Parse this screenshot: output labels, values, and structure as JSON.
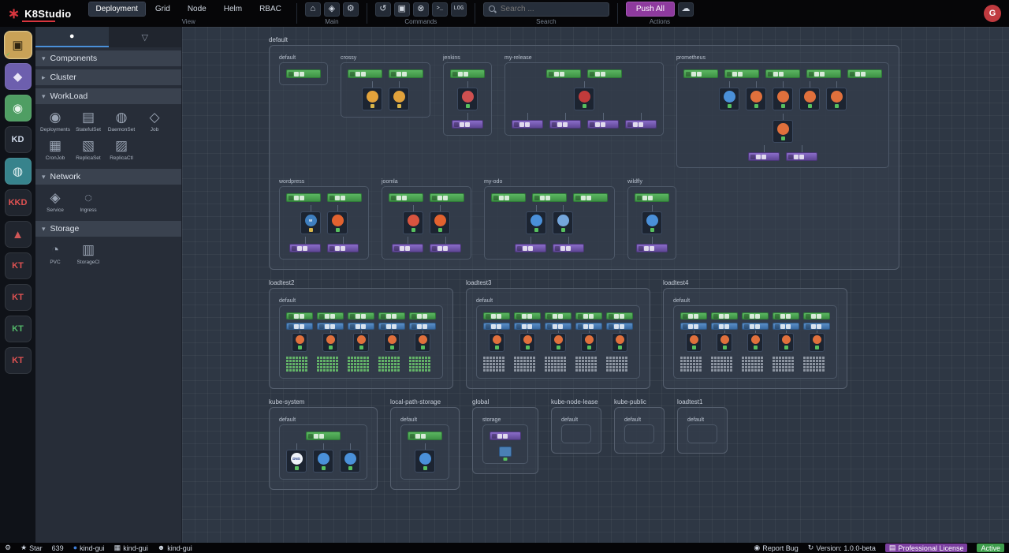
{
  "colors": {
    "accent_blue": "#4a90d9",
    "push_button": "#8e3a9e",
    "avatar_red": "#c03a3f",
    "logo_red": "#d9363e",
    "active_green": "#3f9e4d",
    "license_purple": "#7b3fa0",
    "canvas_bg": "#2e3744"
  },
  "topbar": {
    "logo_text": "K8Studio",
    "group_labels": {
      "view": "View",
      "main": "Main",
      "commands": "Commands",
      "search": "Search",
      "actions": "Actions"
    },
    "tabs": [
      {
        "label": "Deployment",
        "active": true
      },
      {
        "label": "Grid",
        "active": false
      },
      {
        "label": "Node",
        "active": false
      },
      {
        "label": "Helm",
        "active": false
      },
      {
        "label": "RBAC",
        "active": false
      }
    ],
    "main_icons": [
      {
        "name": "home-icon",
        "glyph": "⌂"
      },
      {
        "name": "studio-ship-icon",
        "glyph": "◈"
      },
      {
        "name": "settings-gear-icon",
        "glyph": "⚙"
      }
    ],
    "command_icons": [
      {
        "name": "undo-icon",
        "glyph": "↺"
      },
      {
        "name": "save-icon",
        "glyph": "▣"
      },
      {
        "name": "stop-icon",
        "glyph": "⊗"
      },
      {
        "name": "terminal-icon",
        "glyph": ">_"
      },
      {
        "name": "log-icon",
        "glyph": "LOG"
      }
    ],
    "search_placeholder": "Search ...",
    "push_all_label": "Push All",
    "cloud_icon_glyph": "☁",
    "avatar_letter": "G"
  },
  "rail": {
    "items": [
      {
        "name": "cluster-amber",
        "type": "glyph",
        "glyph": "▣",
        "bg": "#c9a257",
        "fg": "#2e2410",
        "badge": "✓",
        "selected": true
      },
      {
        "name": "cluster-purple",
        "type": "glyph",
        "glyph": "◆",
        "bg": "#6d5fae",
        "fg": "#e8e4f5"
      },
      {
        "name": "cluster-green-pin",
        "type": "glyph",
        "glyph": "◉",
        "bg": "#4f9e63",
        "fg": "#eaf6ee"
      },
      {
        "name": "cluster-kd",
        "type": "text",
        "text": "KD",
        "bg": "#20252e",
        "fg": "#ccd6e6"
      },
      {
        "name": "cluster-teal-flask",
        "type": "glyph",
        "glyph": "◍",
        "bg": "#37838c",
        "fg": "#e7f4f5"
      },
      {
        "name": "cluster-kkd",
        "type": "text",
        "text": "KKD",
        "bg": "#20252e",
        "fg": "#e05252"
      },
      {
        "name": "cluster-rocket",
        "type": "glyph",
        "glyph": "▲",
        "bg": "#20252e",
        "fg": "#d05757"
      },
      {
        "name": "cluster-kt-1",
        "type": "text",
        "text": "KT",
        "bg": "#20252e",
        "fg": "#e05252"
      },
      {
        "name": "cluster-kt-2",
        "type": "text",
        "text": "KT",
        "bg": "#20252e",
        "fg": "#e05252"
      },
      {
        "name": "cluster-kt-3",
        "type": "text",
        "text": "KT",
        "bg": "#20252e",
        "fg": "#53b96a"
      },
      {
        "name": "cluster-kt-4",
        "type": "text",
        "text": "KT",
        "bg": "#20252e",
        "fg": "#e05252"
      }
    ]
  },
  "sidebar": {
    "tabs": [
      {
        "name": "tab-components",
        "glyph": "●",
        "active": true
      },
      {
        "name": "tab-filter",
        "glyph": "▽",
        "active": false
      }
    ],
    "sections": [
      {
        "label": "Components",
        "expanded": true,
        "items": []
      },
      {
        "label": "Cluster",
        "expanded": false,
        "items": []
      },
      {
        "label": "WorkLoad",
        "expanded": true,
        "items": [
          {
            "label": "Deployments",
            "glyph": "◉"
          },
          {
            "label": "StatefulSet",
            "glyph": "▤"
          },
          {
            "label": "DaemonSet",
            "glyph": "◍"
          },
          {
            "label": "Job",
            "glyph": "◇"
          },
          {
            "label": "CronJob",
            "glyph": "▦"
          },
          {
            "label": "ReplicaSet",
            "glyph": "▧"
          },
          {
            "label": "ReplicaCtl",
            "glyph": "▨"
          }
        ]
      },
      {
        "label": "Network",
        "expanded": true,
        "items": [
          {
            "label": "Service",
            "glyph": "◈"
          },
          {
            "label": "Ingress",
            "glyph": "◌"
          }
        ]
      },
      {
        "label": "Storage",
        "expanded": true,
        "items": [
          {
            "label": "PVC",
            "glyph": "◔"
          },
          {
            "label": "StorageCl",
            "glyph": "▥"
          }
        ]
      }
    ]
  },
  "canvas": {
    "namespaces": [
      {
        "name": "default",
        "row": 0,
        "apps": [
          {
            "name": "default",
            "approw": 0,
            "type": "standard",
            "deployments": 1,
            "pods": [],
            "services": 0
          },
          {
            "name": "crossy",
            "approw": 0,
            "type": "standard",
            "deployments": 2,
            "pods": [
              {
                "color": "#e2a23b",
                "status": "#d8b54a"
              },
              {
                "color": "#e2a23b",
                "status": "#d8b54a"
              }
            ],
            "services": 0
          },
          {
            "name": "jenkins",
            "approw": 0,
            "type": "standard",
            "deployments": 1,
            "pods": [
              {
                "color": "#cf5050"
              }
            ],
            "services": 1
          },
          {
            "name": "my-release",
            "approw": 0,
            "type": "standard",
            "deployments": 2,
            "pods": [
              {
                "color": "#c23b3b"
              }
            ],
            "services": 4
          },
          {
            "name": "prometheus",
            "approw": 0,
            "type": "standard",
            "deployments": 5,
            "pods": [
              {
                "color": "#4a90d9"
              },
              {
                "color": "#e0703c"
              },
              {
                "color": "#e0703c"
              },
              {
                "color": "#e0703c"
              },
              {
                "color": "#e0703c"
              }
            ],
            "extra_pods": [
              {
                "color": "#e0703c"
              }
            ],
            "services": 2
          },
          {
            "name": "wordpress",
            "approw": 1,
            "type": "standard",
            "deployments": 2,
            "pods": [
              {
                "color": "#3f7fbf",
                "label": "W",
                "label_color": "#ffffff",
                "status": "#d8b54a"
              },
              {
                "color": "#e2622f"
              }
            ],
            "services": 2
          },
          {
            "name": "joomla",
            "approw": 1,
            "type": "standard",
            "deployments": 2,
            "pods": [
              {
                "color": "#d8543f"
              },
              {
                "color": "#e2622f"
              }
            ],
            "services": 2
          },
          {
            "name": "my-odo",
            "approw": 1,
            "type": "standard",
            "deployments": 3,
            "pods": [
              {
                "color": "#4a90d9"
              },
              {
                "color": "#74a6dc"
              }
            ],
            "services": 2
          },
          {
            "name": "wildfly",
            "approw": 1,
            "type": "standard",
            "deployments": 1,
            "pods": [
              {
                "color": "#4a90d9"
              }
            ],
            "services": 1
          }
        ]
      },
      {
        "name": "loadtest2",
        "row": 1,
        "apps": [
          {
            "name": "default",
            "approw": 0,
            "type": "loadtest",
            "columns": 5,
            "dot_color": "#63b368",
            "dot_rows": 5,
            "dot_cols": 7
          }
        ]
      },
      {
        "name": "loadtest3",
        "row": 1,
        "apps": [
          {
            "name": "default",
            "approw": 0,
            "type": "loadtest",
            "columns": 5,
            "dot_color": "#8d95a1",
            "dot_rows": 5,
            "dot_cols": 7
          }
        ]
      },
      {
        "name": "loadtest4",
        "row": 1,
        "apps": [
          {
            "name": "default",
            "approw": 0,
            "type": "loadtest",
            "columns": 5,
            "dot_color": "#8d95a1",
            "dot_rows": 5,
            "dot_cols": 7
          }
        ]
      },
      {
        "name": "kube-system",
        "row": 2,
        "apps": [
          {
            "name": "default",
            "approw": 0,
            "type": "standard",
            "deployments": 1,
            "pods": [
              {
                "color": "#eef2f8",
                "label": "DNS",
                "label_color": "#27418c"
              },
              {
                "color": "#4a90d9"
              },
              {
                "color": "#4a90d9"
              }
            ],
            "services": 0
          }
        ]
      },
      {
        "name": "local-path-storage",
        "row": 2,
        "apps": [
          {
            "name": "default",
            "approw": 0,
            "type": "standard",
            "deployments": 1,
            "pods": [
              {
                "color": "#4a90d9"
              }
            ],
            "services": 0
          }
        ]
      },
      {
        "name": "global",
        "row": 2,
        "apps": [
          {
            "name": "storage",
            "approw": 0,
            "type": "storage"
          }
        ]
      },
      {
        "name": "kube-node-lease",
        "row": 2,
        "apps": [
          {
            "name": "default",
            "approw": 0,
            "type": "empty"
          }
        ]
      },
      {
        "name": "kube-public",
        "row": 2,
        "apps": [
          {
            "name": "default",
            "approw": 0,
            "type": "empty"
          }
        ]
      },
      {
        "name": "loadtest1",
        "row": 2,
        "apps": [
          {
            "name": "default",
            "approw": 0,
            "type": "empty"
          }
        ]
      }
    ]
  },
  "statusbar": {
    "left": [
      {
        "name": "footer-settings",
        "glyph": "⚙",
        "text": "",
        "interactable": true
      },
      {
        "name": "github-star",
        "glyph": "★",
        "text": "Star",
        "interactable": true
      },
      {
        "name": "star-count",
        "glyph": "",
        "text": "639",
        "interactable": false
      },
      {
        "name": "cluster-context-1",
        "glyph": "●",
        "glyph_color": "#3f7fd9",
        "text": "kind-gui",
        "interactable": true
      },
      {
        "name": "cluster-context-2",
        "glyph": "▦",
        "text": "kind-gui",
        "interactable": true
      },
      {
        "name": "cluster-context-3",
        "glyph": "☻",
        "text": "kind-gui",
        "interactable": true
      }
    ],
    "right": [
      {
        "name": "report-bug",
        "glyph": "◉",
        "text": "Report Bug",
        "interactable": true
      },
      {
        "name": "version",
        "glyph": "↻",
        "text": "Version: 1.0.0-beta",
        "interactable": false
      },
      {
        "name": "license-badge",
        "glyph": "▤",
        "text": "Professional License",
        "badge": "purple",
        "interactable": false
      },
      {
        "name": "active-badge",
        "glyph": "",
        "text": "Active",
        "badge": "green",
        "interactable": false
      }
    ]
  }
}
